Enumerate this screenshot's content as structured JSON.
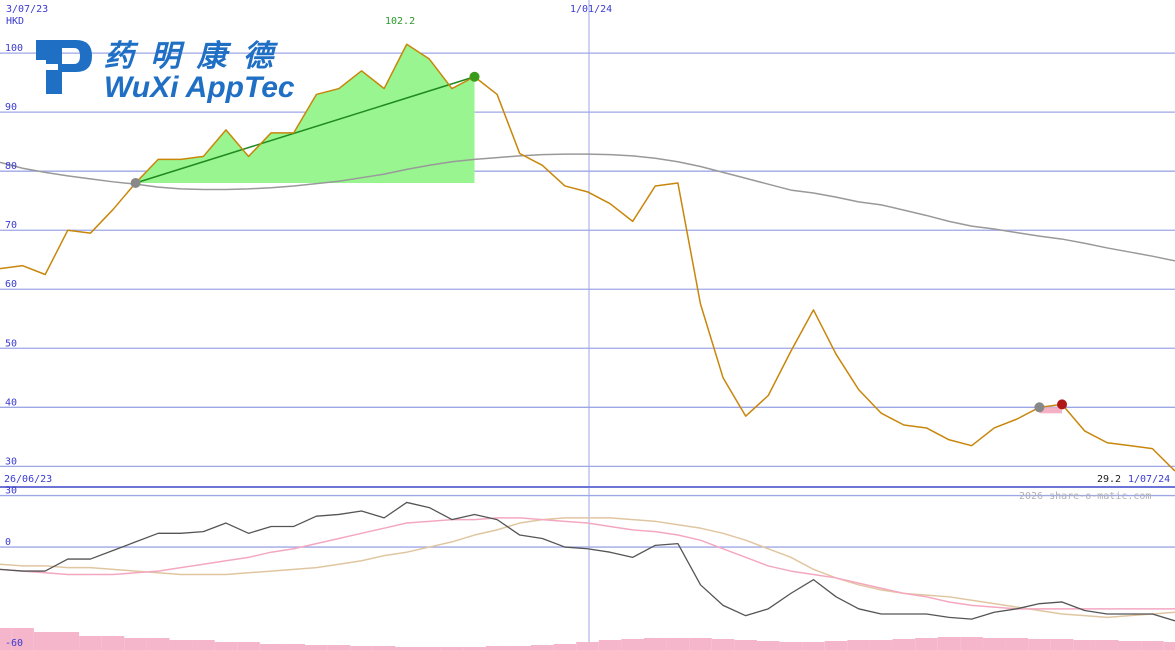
{
  "header": {
    "start_date": "3/07/23",
    "currency": "HKD",
    "mid_date": "1/01/24",
    "peak_label": "102.2"
  },
  "footer": {
    "lower_start_date": "26/06/23",
    "last_value": "29.2",
    "end_date": "1/07/24",
    "copyright": "2026 share-o-matic.com"
  },
  "logo": {
    "chinese": "药 明 康 德",
    "english": "WuXi AppTec"
  },
  "colors": {
    "price": "#c8860a",
    "ma": "#999999",
    "grid": "#9ea7e6",
    "highlight_fill": "#98f590",
    "trend_line": "#1f8a1f",
    "buy_marker": "#3a9a1a",
    "sell_marker": "#b01818",
    "osc_fast": "#555555",
    "osc_pink": "#f4a8c0",
    "osc_tan": "#e0c6a0",
    "volume": "#f5b6cc",
    "logo_blue": "#1f6fc4"
  },
  "chart_data": [
    {
      "type": "line",
      "ylabel": "HKD",
      "ylim": [
        26.5,
        109
      ],
      "yticks": [
        30,
        40,
        50,
        60,
        70,
        80,
        90,
        100
      ],
      "series": [
        {
          "values": [
            63.5,
            64,
            62.5,
            70,
            69.5,
            73.5,
            78,
            82,
            82,
            82.5,
            87,
            82.5,
            86.5,
            86.5,
            93,
            94,
            97,
            94,
            101.5,
            99,
            94,
            96,
            93,
            83,
            81,
            77.5,
            76.5,
            74.5,
            71.5,
            77.5,
            78,
            57.5,
            45,
            38.5,
            42,
            49.5,
            56.5,
            49,
            43,
            39,
            37,
            36.5,
            34.5,
            33.5,
            36.5,
            38,
            40,
            40.5,
            36,
            34,
            33.5,
            33,
            29.2
          ]
        },
        {
          "values": [
            81.5,
            80.5,
            79.8,
            79.2,
            78.7,
            78.2,
            77.8,
            77.3,
            77,
            76.9,
            76.9,
            77,
            77.2,
            77.5,
            77.9,
            78.3,
            78.9,
            79.5,
            80.3,
            81,
            81.6,
            82,
            82.3,
            82.6,
            82.8,
            82.9,
            82.9,
            82.8,
            82.6,
            82.2,
            81.6,
            80.8,
            79.8,
            78.8,
            77.8,
            76.8,
            76.3,
            75.6,
            74.8,
            74.3,
            73.4,
            72.5,
            71.5,
            70.7,
            70.2,
            69.6,
            69,
            68.5,
            67.8,
            67,
            66.3,
            65.6,
            64.8
          ]
        }
      ],
      "annotations": [
        "102.2",
        "29.2"
      ]
    },
    {
      "type": "line",
      "ylim": [
        -60,
        35
      ],
      "yticks": [
        -60,
        0,
        30
      ],
      "series": [
        {
          "values": [
            -13,
            -14,
            -14,
            -7,
            -7,
            -2,
            3,
            8,
            8,
            9,
            14,
            8,
            12,
            12,
            18,
            19,
            21,
            17,
            26,
            23,
            16,
            19,
            16,
            7,
            5,
            0,
            -1,
            -3,
            -6,
            1,
            2,
            -22,
            -34,
            -40,
            -36,
            -27,
            -19,
            -29,
            -36,
            -39,
            -39,
            -39,
            -41,
            -42,
            -38,
            -36,
            -33,
            -32,
            -37,
            -39,
            -39,
            -39,
            -43
          ]
        },
        {
          "values": [
            -13,
            -14,
            -15,
            -16,
            -16,
            -16,
            -15,
            -14,
            -12,
            -10,
            -8,
            -6,
            -3,
            -1,
            2,
            5,
            8,
            11,
            14,
            15,
            16,
            16,
            17,
            17,
            16,
            15,
            14,
            12,
            10,
            9,
            7,
            4,
            -1,
            -6,
            -11,
            -14,
            -16,
            -18,
            -21,
            -24,
            -27,
            -29,
            -32,
            -34,
            -35,
            -36,
            -36,
            -36,
            -36,
            -36,
            -36,
            -36,
            -36
          ]
        },
        {
          "values": [
            -10,
            -11,
            -11,
            -12,
            -12,
            -13,
            -14,
            -15,
            -16,
            -16,
            -16,
            -15,
            -14,
            -13,
            -12,
            -10,
            -8,
            -5,
            -3,
            0,
            3,
            7,
            10,
            14,
            16,
            17,
            17,
            17,
            16,
            15,
            13,
            11,
            8,
            4,
            -1,
            -6,
            -13,
            -18,
            -22,
            -25,
            -27,
            -28,
            -29,
            -31,
            -33,
            -35,
            -37,
            -39,
            -40,
            -41,
            -40,
            -39,
            -38
          ]
        }
      ]
    }
  ]
}
